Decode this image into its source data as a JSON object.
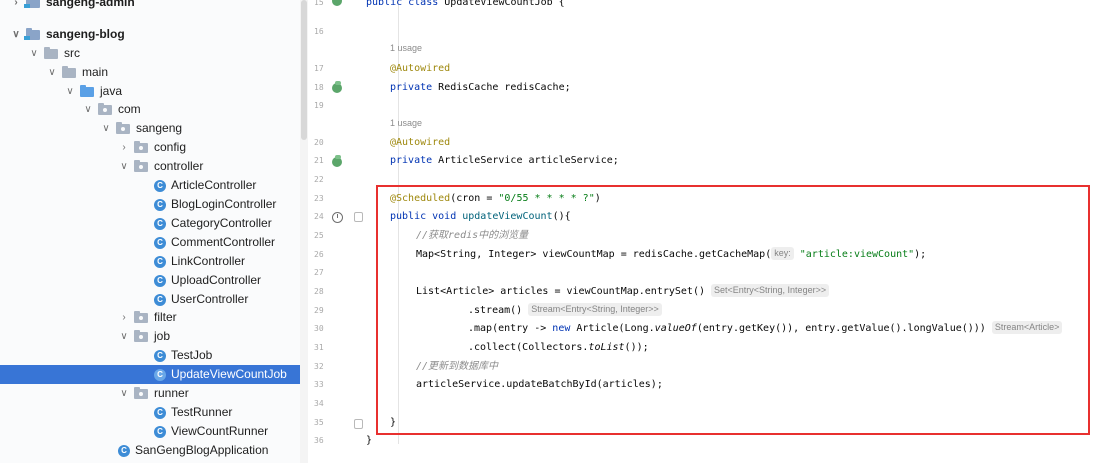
{
  "project_tree": {
    "items": [
      {
        "label": "sangeng-admin",
        "kind": "module",
        "expanded": false
      },
      {
        "label": "sangeng-blog",
        "kind": "module",
        "expanded": true
      },
      {
        "label": "src",
        "kind": "folder",
        "expanded": true
      },
      {
        "label": "main",
        "kind": "folder",
        "expanded": true
      },
      {
        "label": "java",
        "kind": "source-folder",
        "expanded": true
      },
      {
        "label": "com",
        "kind": "package",
        "expanded": true
      },
      {
        "label": "sangeng",
        "kind": "package",
        "expanded": true
      },
      {
        "label": "config",
        "kind": "package",
        "expanded": false
      },
      {
        "label": "controller",
        "kind": "package",
        "expanded": true
      },
      {
        "label": "ArticleController",
        "kind": "class"
      },
      {
        "label": "BlogLoginController",
        "kind": "class"
      },
      {
        "label": "CategoryController",
        "kind": "class"
      },
      {
        "label": "CommentController",
        "kind": "class"
      },
      {
        "label": "LinkController",
        "kind": "class"
      },
      {
        "label": "UploadController",
        "kind": "class"
      },
      {
        "label": "UserController",
        "kind": "class"
      },
      {
        "label": "filter",
        "kind": "package",
        "expanded": false
      },
      {
        "label": "job",
        "kind": "package",
        "expanded": true
      },
      {
        "label": "TestJob",
        "kind": "class"
      },
      {
        "label": "UpdateViewCountJob",
        "kind": "class",
        "selected": true
      },
      {
        "label": "runner",
        "kind": "package",
        "expanded": true
      },
      {
        "label": "TestRunner",
        "kind": "class"
      },
      {
        "label": "ViewCountRunner",
        "kind": "class"
      },
      {
        "label": "SanGengBlogApplication",
        "kind": "class"
      }
    ]
  },
  "editor": {
    "line_numbers": [
      "15",
      "16",
      "",
      "17",
      "18",
      "19",
      "",
      "20",
      "21",
      "22",
      "23",
      "24",
      "25",
      "26",
      "27",
      "28",
      "29",
      "30",
      "31",
      "32",
      "33",
      "34",
      "35",
      "36"
    ],
    "usage_hint": "1 usage",
    "code": {
      "l15_kw": "public class ",
      "l15_name": "UpdateViewCountJob {",
      "l17": "@Autowired",
      "l18_kw": "private ",
      "l18_rest": "RedisCache redisCache;",
      "l20": "@Autowired",
      "l21_kw": "private ",
      "l21_rest": "ArticleService articleService;",
      "l23_an": "@Scheduled",
      "l23_p1": "(cron = ",
      "l23_str": "\"0/55 * * * * ?\"",
      "l23_p2": ")",
      "l24_kw": "public void ",
      "l24_fn": "updateViewCount",
      "l24_rest": "(){",
      "l25": "//获取redis中的浏览量",
      "l26_a": "Map<String, Integer> viewCountMap = redisCache.getCacheMap(",
      "l26_hint": "key:",
      "l26_str": "\"article:viewCount\"",
      "l26_b": ");",
      "l28_a": "List<Article> articles = viewCountMap.entrySet()",
      "l28_hint": "Set<Entry<String, Integer>>",
      "l29_a": ".stream()",
      "l29_hint": "Stream<Entry<String, Integer>>",
      "l30_a": ".map(entry -> ",
      "l30_kw": "new ",
      "l30_b": "Article(Long.",
      "l30_it": "valueOf",
      "l30_c": "(entry.getKey()), entry.getValue().longValue()))",
      "l30_hint": "Stream<Article>",
      "l31_a": ".collect(Collectors.",
      "l31_it": "toList",
      "l31_b": "());",
      "l32": "//更新到数据库中",
      "l33": "articleService.updateBatchById(articles);",
      "l35": "}",
      "l36": "}"
    }
  },
  "annotation": {
    "highlight_color": "#e8302f"
  }
}
